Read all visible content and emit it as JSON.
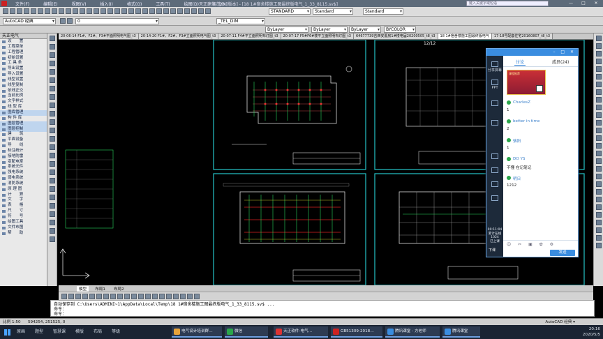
{
  "titlebar": {
    "menus": [
      "文件(F)",
      "编辑(E)",
      "视图(V)",
      "插入(I)",
      "格式(O)",
      "工具(T)",
      "绘图(D)",
      "标注(N)"
    ],
    "title": "天正建筑 T20 [版本] - [18 1#宿舍楼施工图最终版电气_1_33_8115.sv$]",
    "search_placeholder": "键入关键字或短语",
    "window_controls": [
      "—",
      "□",
      "✕"
    ]
  },
  "toolbar": {
    "style_combo": "STANDARD",
    "text_style_combo": "Standard",
    "dim_style_combo": "_TEL_DIM",
    "table_style_combo": "Standard",
    "workspace_combo": "AutoCAD 经典",
    "layer_combo": "0",
    "color_combo": "ByLayer",
    "linetype_combo": "ByLayer",
    "lineweight_combo": "ByLayer",
    "plot_combo": "BYCOLOR"
  },
  "doc_tabs": [
    {
      "label": "20-06-14 F1#、F2#、F3#平面照明电气图_t3",
      "active": false
    },
    {
      "label": "20-14-20 F1#、F2#、F3#立面照明电气图_t3",
      "active": false
    },
    {
      "label": "20-07-11 F4#平立面照明布灯图_t3",
      "active": false
    },
    {
      "label": "20-07-17 F5#F6#楼平立面照明布灯图_t3",
      "active": false
    },
    {
      "label": "64677739吉西安置房1#楼电届20200505_t8_t3",
      "active": false
    },
    {
      "label": "18 1#宿舍楼施工图最终版电气",
      "active": true
    },
    {
      "label": "17-18号配套住宅20160807_t8_t3",
      "active": false
    }
  ],
  "left_panel": {
    "title": "天正电气",
    "items": [
      {
        "label": "设　　置",
        "hl": false
      },
      {
        "label": "工程菜单",
        "hl": false
      },
      {
        "label": "工程管理",
        "hl": false
      },
      {
        "label": "初始设置",
        "hl": false
      },
      {
        "label": "工 具 条",
        "hl": false
      },
      {
        "label": "导出设置",
        "hl": false
      },
      {
        "label": "导入设置",
        "hl": false
      },
      {
        "label": "线型设置",
        "hl": false
      },
      {
        "label": "线型复制",
        "hl": false
      },
      {
        "label": "依线正交",
        "hl": false
      },
      {
        "label": "当前比例",
        "hl": false
      },
      {
        "label": "文字样式",
        "hl": false
      },
      {
        "label": "线 型 库",
        "hl": false
      },
      {
        "label": "图库管理",
        "hl": true
      },
      {
        "label": "构 件 库",
        "hl": false
      },
      {
        "label": "图层管理",
        "hl": true
      },
      {
        "label": "图层控制",
        "hl": true
      },
      {
        "label": "建　　筑",
        "hl": false
      },
      {
        "label": "平面设备",
        "hl": false
      },
      {
        "label": "导　　线",
        "hl": false
      },
      {
        "label": "标注统计",
        "hl": false
      },
      {
        "label": "接地防雷",
        "hl": false
      },
      {
        "label": "变配电室",
        "hl": false
      },
      {
        "label": "系统元件",
        "hl": false
      },
      {
        "label": "强电系统",
        "hl": false
      },
      {
        "label": "弱电系统",
        "hl": false
      },
      {
        "label": "消防系统",
        "hl": false
      },
      {
        "label": "原 理 图",
        "hl": false
      },
      {
        "label": "计　　算",
        "hl": false
      },
      {
        "label": "文　　字",
        "hl": false
      },
      {
        "label": "表　　格",
        "hl": false
      },
      {
        "label": "尺　　寸",
        "hl": false
      },
      {
        "label": "符　　号",
        "hl": false
      },
      {
        "label": "绘图工具",
        "hl": false
      },
      {
        "label": "文件布图",
        "hl": false
      },
      {
        "label": "帮　　助",
        "hl": false
      }
    ]
  },
  "drawing": {
    "sheet_label": "12/12"
  },
  "layout_tabs": [
    "模型",
    "布局1",
    "布局2"
  ],
  "bottom_toolbar_right": "AutoCAD 经典 ▾",
  "command": {
    "line1": "自动保存到 C:\\Users\\ADMINI~1\\AppData\\Local\\Temp\\18 1#宿舍楼施工图最终版电气_1_33_8115.sv$ ...",
    "line2": "命令：",
    "line3": "命令："
  },
  "statusbar": {
    "scale": "比例 1:50",
    "coords": "594254, 251525, 0",
    "right": "AutoCAD 经典 ▾"
  },
  "taskbar": {
    "menus": [
      "原画",
      "题型",
      "智慧课",
      "模版",
      "布局",
      "等级"
    ],
    "tasks": [
      {
        "label": "电气设计培训群…",
        "color": "#e8a33a"
      },
      {
        "label": "微信",
        "color": "#2aa64b"
      },
      {
        "label": "天正软件-电气…",
        "color": "#d33"
      },
      {
        "label": "GB51309-2018…",
        "color": "#c22"
      },
      {
        "label": "腾讯课堂 - 方老师",
        "color": "#3a8de0"
      },
      {
        "label": "腾讯课堂",
        "color": "#3a8de0"
      }
    ],
    "time": "20:16",
    "date": "2020/5/5"
  },
  "chat": {
    "tab_discuss": "讨论",
    "tab_members": "成员(24)",
    "side_share": "分享屏幕",
    "side_ppt": "PPT",
    "timer_label": "00:11:04",
    "timer_sub": "累计在线",
    "timer_count": "1024",
    "timer_sub2": "已上课",
    "exit_label": "下课",
    "poster_text": "课程推荐",
    "messages": [
      {
        "name": "CharlesZ",
        "text": "1"
      },
      {
        "name": "better in time",
        "text": "2"
      },
      {
        "name": "骆阳",
        "text": "1"
      },
      {
        "name": "DO YS",
        "text": "不懂 在记笔记"
      },
      {
        "name": "明日",
        "text": "1212"
      }
    ],
    "send_label": "发送"
  }
}
